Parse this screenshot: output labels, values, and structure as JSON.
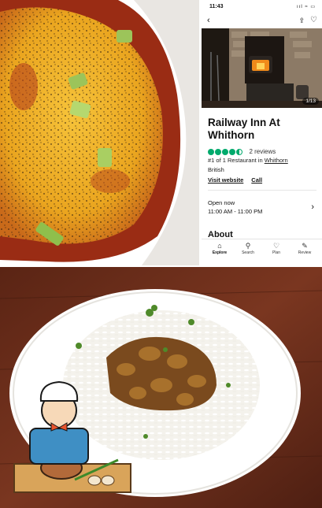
{
  "status_bar": {
    "time": "11:43",
    "icons": "ııl ≈ ▭"
  },
  "nav": {
    "back_icon": "back-arrow-icon",
    "share_icon": "share-icon",
    "save_icon": "heart-icon"
  },
  "listing": {
    "photo_counter": "1/13",
    "name": "Railway Inn At Whithorn",
    "rating_bubbles": 4.5,
    "reviews": "2 reviews",
    "rank_text": "#1 of 1 Restaurant in ",
    "rank_place": "Whithorn",
    "cuisine": "British",
    "website_label": "Visit website",
    "call_label": "Call",
    "open_status": "Open now",
    "hours": "11:00 AM - 11:00 PM",
    "about_label": "About"
  },
  "tabs": [
    {
      "label": "Explore",
      "icon": "home-icon"
    },
    {
      "label": "Search",
      "icon": "search-icon"
    },
    {
      "label": "Plan",
      "icon": "heart-icon"
    },
    {
      "label": "Review",
      "icon": "pencil-icon"
    }
  ],
  "colors": {
    "rating_green": "#00aa6c",
    "table_wood": "#6b2e1a",
    "plate": "#ffffff"
  }
}
